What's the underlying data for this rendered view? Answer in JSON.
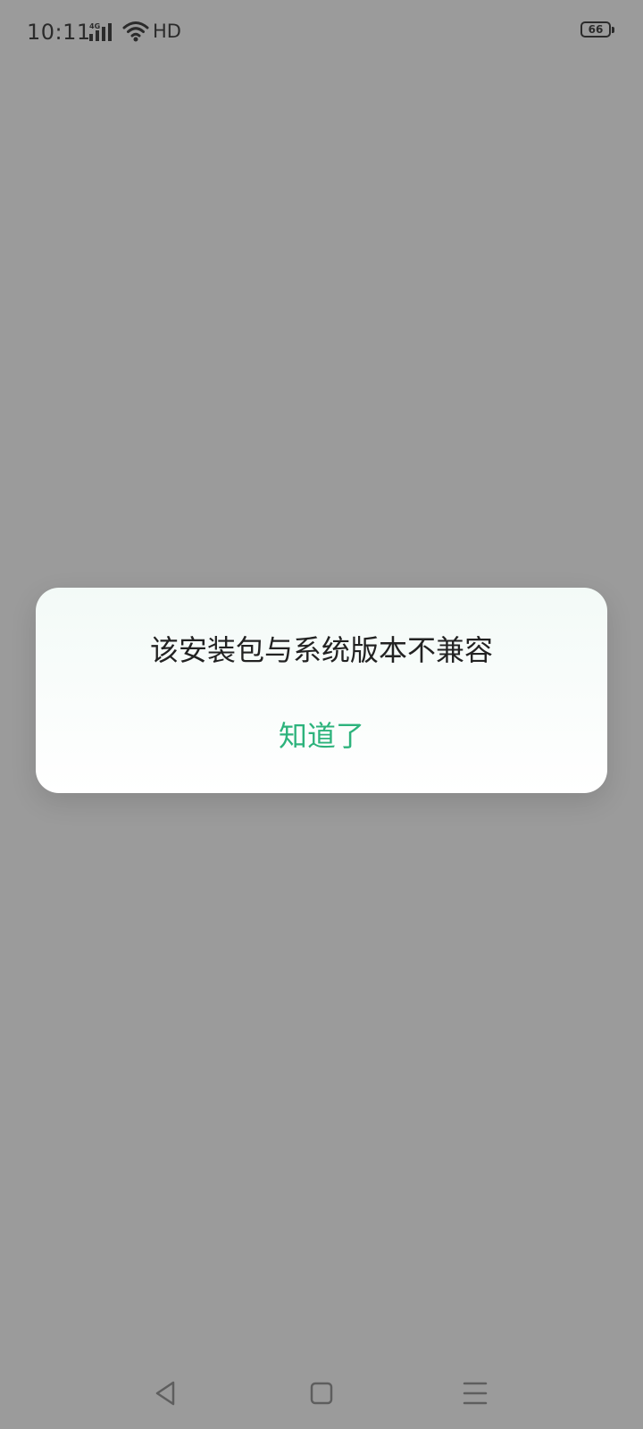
{
  "status_bar": {
    "time": "10:11",
    "network_type": "4G",
    "hd_label": "HD",
    "battery_level": "66",
    "icons": [
      "signal-icon",
      "wifi-icon",
      "battery-icon"
    ]
  },
  "dialog": {
    "message": "该安装包与系统版本不兼容",
    "button_label": "知道了",
    "button_color": "#2db37c"
  },
  "nav_bar": {
    "icons": [
      "back-icon",
      "home-icon",
      "recent-apps-icon"
    ]
  },
  "colors": {
    "overlay": "#9b9b9b",
    "dialog_background": "#ffffff",
    "accent": "#2db37c"
  }
}
